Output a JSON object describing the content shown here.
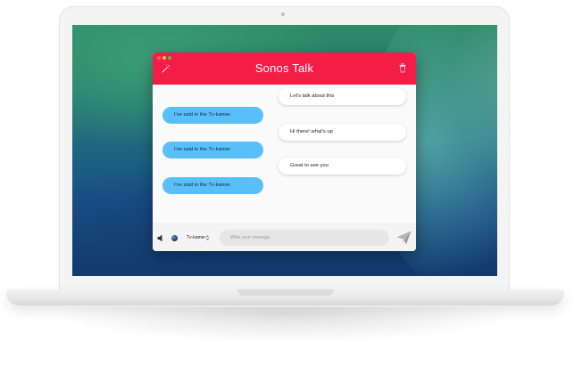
{
  "app": {
    "title": "Sonos Talk",
    "accent_color": "#f31d47",
    "bubble_left_color": "#59bff9",
    "bubble_right_color": "#ffffff"
  },
  "titlebar_icons": {
    "left": "magic-wand-icon",
    "right": "trash-icon"
  },
  "messages": [
    {
      "side": "right",
      "text": "Let's talk about this"
    },
    {
      "side": "left",
      "text": "I've said in the Tv-kamer."
    },
    {
      "side": "right",
      "text": "Hi there! what's up"
    },
    {
      "side": "left",
      "text": "I've said in the Tv-kamer."
    },
    {
      "side": "right",
      "text": "Great to see you"
    },
    {
      "side": "left",
      "text": "I've said in the Tv-kamer."
    }
  ],
  "composer": {
    "speaker_icon": "speaker-icon",
    "device_icon": "device-globe-icon",
    "device_selected": "Tv-kamer",
    "input_value": "",
    "input_placeholder": "Write your message",
    "send_icon": "paper-plane-icon"
  }
}
